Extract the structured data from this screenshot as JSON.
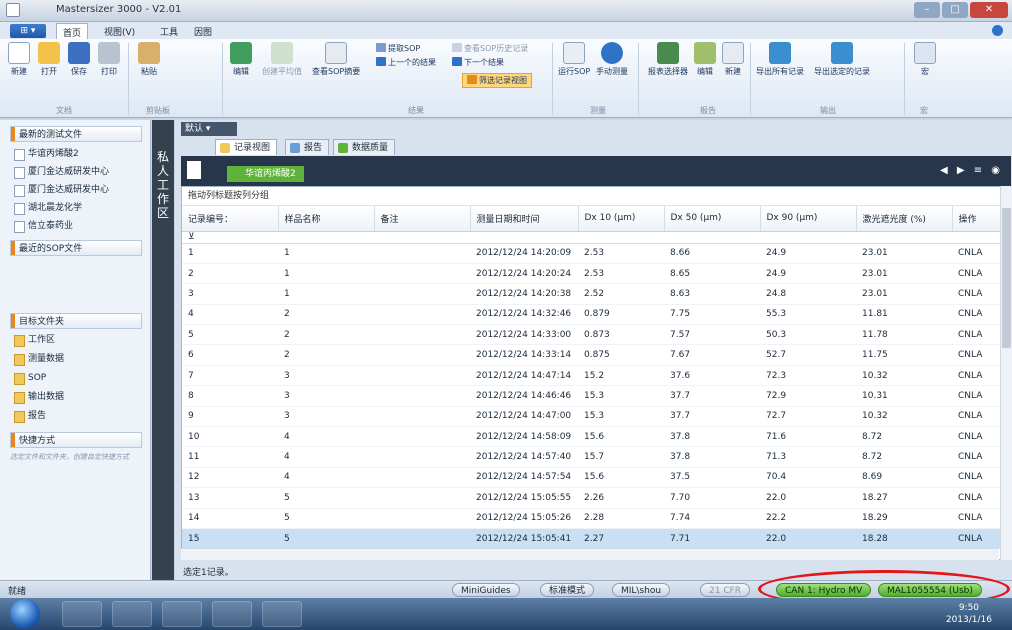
{
  "app": {
    "title": "Mastersizer 3000 - V2.01"
  },
  "menu": {
    "app_button": "⊞ ▾",
    "items": [
      "首页",
      "视图(V)",
      "工具",
      "因图"
    ]
  },
  "ribbon": {
    "file_buttons": [
      "新建",
      "打开",
      "保存",
      "打印"
    ],
    "clipboard_buttons": [
      "粘贴"
    ],
    "results_buttons": [
      "编辑",
      "创建平均值",
      "查看SOP摘要"
    ],
    "results_small": [
      "提取SOP",
      "上一个的结果",
      "查看SOP历史记录",
      "下一个结果",
      "筛选记录视图"
    ],
    "measure_buttons": [
      "运行SOP",
      "手动测量"
    ],
    "report_buttons": [
      "报表选择器",
      "编辑",
      "新建"
    ],
    "output_buttons": [
      "导出所有记录",
      "导出选定的记录"
    ],
    "macro_buttons": [
      "宏"
    ],
    "groups": [
      "文档",
      "剪贴板",
      "结果",
      "测量",
      "报告",
      "输出",
      "宏"
    ]
  },
  "sidebar": {
    "recent_header": "最新的测试文件",
    "recent_files": [
      "华谊丙烯酸2",
      "厦门金达威研发中心",
      "厦门金达威研发中心",
      "湖北晨龙化学",
      "信立泰药业"
    ],
    "sop_header": "最近的SOP文件",
    "target_header": "目标文件夹",
    "target_items": [
      "工作区",
      "测量数据",
      "SOP",
      "输出数据",
      "报告"
    ],
    "shortcut_header": "快捷方式",
    "shortcut_hint": "选定文件和文件夹，创建自定快捷方式"
  },
  "vertical_tab": "私人工作区",
  "workspace": {
    "dropdown": "默认",
    "tabs": [
      "记录视图",
      "报告",
      "数据质量"
    ],
    "document": "华谊丙烯酸2",
    "group_hint": "拖动列标题按列分组",
    "selection_count": "选定1记录。"
  },
  "table": {
    "columns": [
      "记录编号：",
      "样品名称",
      "备注",
      "测量日期和时间",
      "Dx 10 (µm)",
      "Dx 50 (µm)",
      "Dx 90 (µm)",
      "激光遮光度 (%)",
      "操作"
    ],
    "rows": [
      [
        "1",
        "1",
        "",
        "2012/12/24 14:20:09",
        "2.53",
        "8.66",
        "24.9",
        "23.01",
        "CNLA"
      ],
      [
        "2",
        "1",
        "",
        "2012/12/24 14:20:24",
        "2.53",
        "8.65",
        "24.9",
        "23.01",
        "CNLA"
      ],
      [
        "3",
        "1",
        "",
        "2012/12/24 14:20:38",
        "2.52",
        "8.63",
        "24.8",
        "23.01",
        "CNLA"
      ],
      [
        "4",
        "2",
        "",
        "2012/12/24 14:32:46",
        "0.879",
        "7.75",
        "55.3",
        "11.81",
        "CNLA"
      ],
      [
        "5",
        "2",
        "",
        "2012/12/24 14:33:00",
        "0.873",
        "7.57",
        "50.3",
        "11.78",
        "CNLA"
      ],
      [
        "6",
        "2",
        "",
        "2012/12/24 14:33:14",
        "0.875",
        "7.67",
        "52.7",
        "11.75",
        "CNLA"
      ],
      [
        "7",
        "3",
        "",
        "2012/12/24 14:47:14",
        "15.2",
        "37.6",
        "72.3",
        "10.32",
        "CNLA"
      ],
      [
        "8",
        "3",
        "",
        "2012/12/24 14:46:46",
        "15.3",
        "37.7",
        "72.9",
        "10.31",
        "CNLA"
      ],
      [
        "9",
        "3",
        "",
        "2012/12/24 14:47:00",
        "15.3",
        "37.7",
        "72.7",
        "10.32",
        "CNLA"
      ],
      [
        "10",
        "4",
        "",
        "2012/12/24 14:58:09",
        "15.6",
        "37.8",
        "71.6",
        "8.72",
        "CNLA"
      ],
      [
        "11",
        "4",
        "",
        "2012/12/24 14:57:40",
        "15.7",
        "37.8",
        "71.3",
        "8.72",
        "CNLA"
      ],
      [
        "12",
        "4",
        "",
        "2012/12/24 14:57:54",
        "15.6",
        "37.5",
        "70.4",
        "8.69",
        "CNLA"
      ],
      [
        "13",
        "5",
        "",
        "2012/12/24 15:05:55",
        "2.26",
        "7.70",
        "22.0",
        "18.27",
        "CNLA"
      ],
      [
        "14",
        "5",
        "",
        "2012/12/24 15:05:26",
        "2.28",
        "7.74",
        "22.2",
        "18.29",
        "CNLA"
      ],
      [
        "15",
        "5",
        "",
        "2012/12/24 15:05:41",
        "2.27",
        "7.71",
        "22.0",
        "18.28",
        "CNLA"
      ]
    ],
    "selected_row": 15
  },
  "statusbar": {
    "ready": "就绪",
    "miniguides": "MiniGuides",
    "mode": "标准模式",
    "user": "MIL\\shou",
    "cfr": "21 CFR",
    "accessory": "CAN 1: Hydro MV",
    "instrument": "MAL1055554 (Usb)"
  },
  "taskbar": {
    "time": "9:50",
    "date": "2013/1/16"
  },
  "colors": {
    "accent": "#e8871e",
    "status_green": "#4fae2b",
    "highlight_red": "#e4161b",
    "dark_nav": "#27364a"
  }
}
